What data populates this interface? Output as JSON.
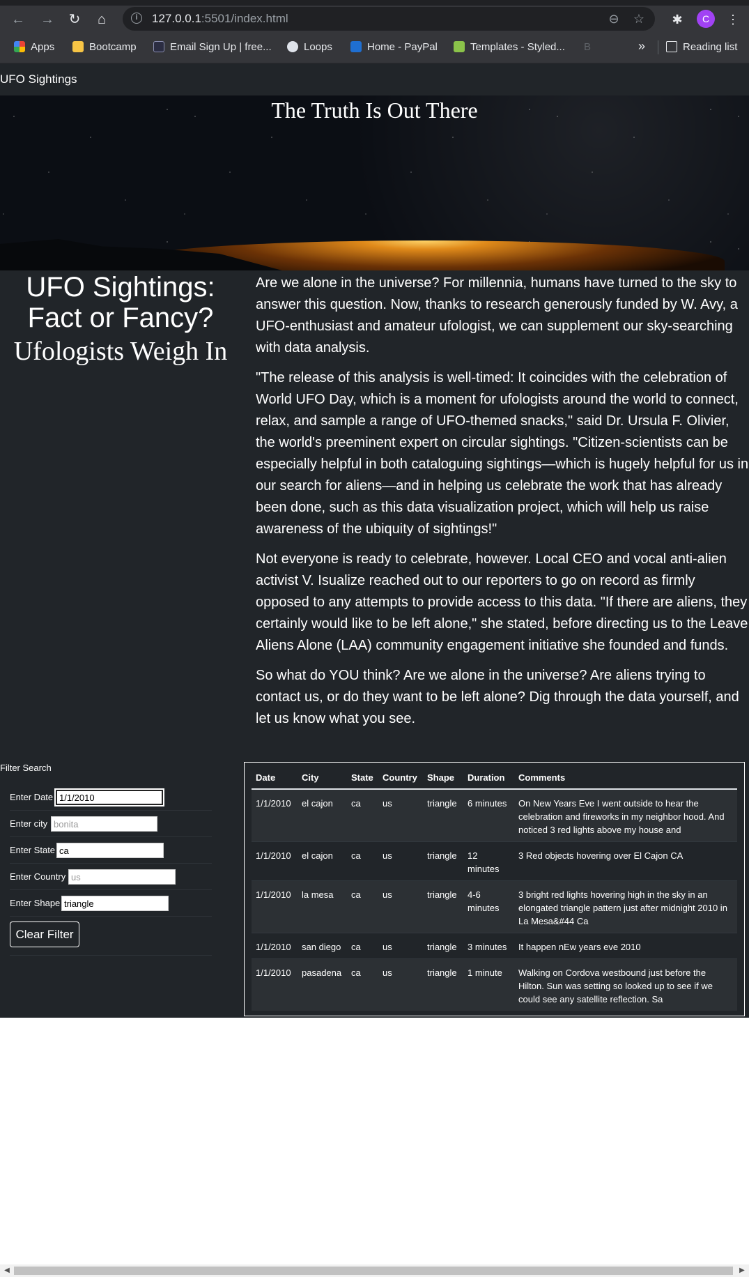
{
  "browser": {
    "url_host": "127.0.0.1",
    "url_rest": ":5501/index.html",
    "avatar_letter": "C",
    "bookmarks": [
      "Apps",
      "Bootcamp",
      "Email Sign Up | free...",
      "Loops",
      "Home - PayPal",
      "Templates - Styled...",
      "B"
    ],
    "more_label": "»",
    "reading_list": "Reading list",
    "icons": [
      "back-arrow-icon",
      "forward-arrow-icon",
      "reload-icon",
      "home-icon",
      "info-icon",
      "zoom-out-icon",
      "star-icon",
      "extensions-icon",
      "menu-dots-icon"
    ]
  },
  "page": {
    "brand": "UFO Sightings",
    "hero_title": "The Truth Is Out There",
    "headline": "UFO Sightings: Fact or Fancy?",
    "subheadline": "Ufologists Weigh In",
    "paragraphs": [
      "Are we alone in the universe? For millennia, humans have turned to the sky to answer this question. Now, thanks to research generously funded by W. Avy, a UFO-enthusiast and amateur ufologist, we can supplement our sky-searching with data analysis.",
      "\"The release of this analysis is well-timed: It coincides with the celebration of World UFO Day, which is a moment for ufologists around the world to connect, relax, and sample a range of UFO-themed snacks,\" said Dr. Ursula F. Olivier, the world's preeminent expert on circular sightings. \"Citizen-scientists can be especially helpful in both cataloguing sightings—which is hugely helpful for us in our search for aliens—and in helping us celebrate the work that has already been done, such as this data visualization project, which will help us raise awareness of the ubiquity of sightings!\"",
      "Not everyone is ready to celebrate, however. Local CEO and vocal anti-alien activist V. Isualize reached out to our reporters to go on record as firmly opposed to any attempts to provide access to this data. \"If there are aliens, they certainly would like to be left alone,\" she stated, before directing us to the Leave Aliens Alone (LAA) community engagement initiative she founded and funds.",
      "So what do YOU think? Are we alone in the universe? Are aliens trying to contact us, or do they want to be left alone? Dig through the data yourself, and let us know what you see."
    ]
  },
  "filter": {
    "title": "Filter Search",
    "fields": [
      {
        "label": "Enter Date",
        "value": "1/1/2010",
        "placeholder": "1/1/2010"
      },
      {
        "label": "Enter city",
        "value": "",
        "placeholder": "bonita"
      },
      {
        "label": "Enter State",
        "value": "ca",
        "placeholder": "ca"
      },
      {
        "label": "Enter Country",
        "value": "",
        "placeholder": "us"
      },
      {
        "label": "Enter Shape",
        "value": "triangle",
        "placeholder": "triangle"
      }
    ],
    "clear_label": "Clear Filter"
  },
  "table": {
    "headers": [
      "Date",
      "City",
      "State",
      "Country",
      "Shape",
      "Duration",
      "Comments"
    ],
    "rows": [
      [
        "1/1/2010",
        "el cajon",
        "ca",
        "us",
        "triangle",
        "6 minutes",
        "On New Years Eve I went outside to hear the celebration and fireworks in my neighbor hood. And noticed 3 red lights above my house and"
      ],
      [
        "1/1/2010",
        "el cajon",
        "ca",
        "us",
        "triangle",
        "12 minutes",
        "3 Red objects hovering over El Cajon CA"
      ],
      [
        "1/1/2010",
        "la mesa",
        "ca",
        "us",
        "triangle",
        "4-6 minutes",
        "3 bright red lights hovering high in the sky in an elongated triangle pattern just after midnight 2010 in La Mesa&#44 Ca"
      ],
      [
        "1/1/2010",
        "san diego",
        "ca",
        "us",
        "triangle",
        "3 minutes",
        "It happen nEw years eve 2010"
      ],
      [
        "1/1/2010",
        "pasadena",
        "ca",
        "us",
        "triangle",
        "1 minute",
        "Walking on Cordova westbound just before the Hilton. Sun was setting so looked up to see if we could see any satellite reflection. Sa"
      ]
    ]
  },
  "colors": {
    "navbar": "#212529",
    "avatar": "#a142f4",
    "chrome": "#35363a"
  }
}
